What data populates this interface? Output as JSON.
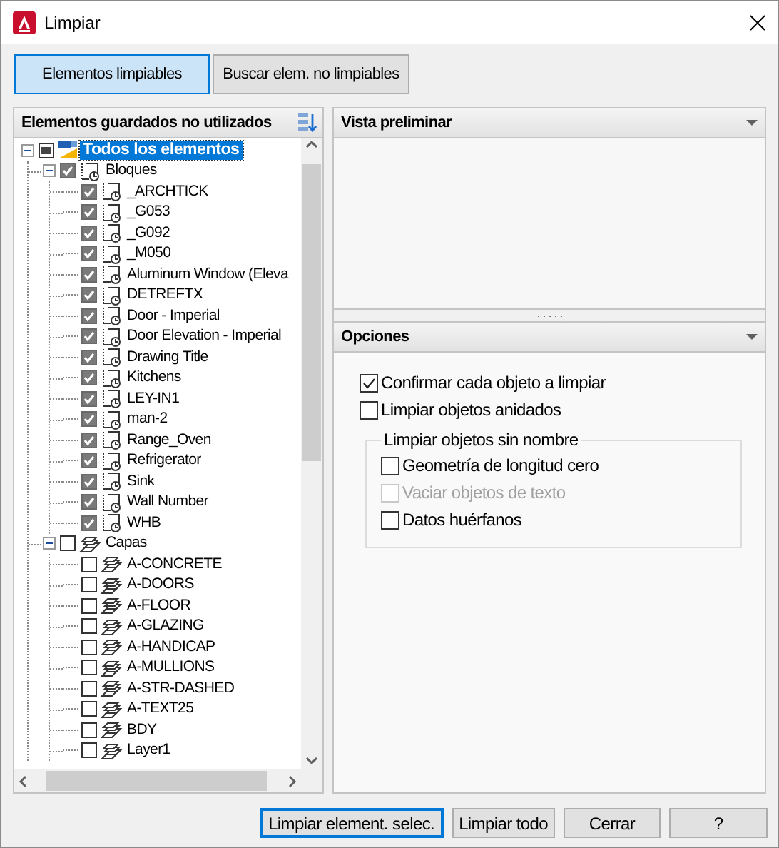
{
  "window": {
    "title": "Limpiar"
  },
  "mode_tabs": [
    {
      "label": "Elementos limpiables",
      "selected": true
    },
    {
      "label": "Buscar elem. no limpiables",
      "selected": false
    }
  ],
  "tree_panel": {
    "title": "Elementos guardados no utilizados",
    "root": {
      "label": "Todos los elementos",
      "kind": "all",
      "selected": true,
      "expanded": true,
      "indeterminate": true,
      "children": [
        {
          "label": "Bloques",
          "kind": "block",
          "selected": false,
          "expanded": true,
          "checked": true,
          "children": [
            {
              "label": "_ARCHTICK",
              "kind": "block",
              "selected": false,
              "checked": true
            },
            {
              "label": "_G053",
              "kind": "block",
              "selected": false,
              "checked": true
            },
            {
              "label": "_G092",
              "kind": "block",
              "selected": false,
              "checked": true
            },
            {
              "label": "_M050",
              "kind": "block",
              "selected": false,
              "checked": true
            },
            {
              "label": "Aluminum Window (Eleva",
              "kind": "block",
              "selected": false,
              "checked": true
            },
            {
              "label": "DETREFTX",
              "kind": "block",
              "selected": false,
              "checked": true
            },
            {
              "label": "Door - Imperial",
              "kind": "block",
              "selected": false,
              "checked": true
            },
            {
              "label": "Door Elevation - Imperial",
              "kind": "block",
              "selected": false,
              "checked": true
            },
            {
              "label": "Drawing Title",
              "kind": "block",
              "selected": false,
              "checked": true
            },
            {
              "label": "Kitchens",
              "kind": "block",
              "selected": false,
              "checked": true
            },
            {
              "label": "LEY-IN1",
              "kind": "block",
              "selected": false,
              "checked": true
            },
            {
              "label": "man-2",
              "kind": "block",
              "selected": false,
              "checked": true
            },
            {
              "label": "Range_Oven",
              "kind": "block",
              "selected": false,
              "checked": true
            },
            {
              "label": "Refrigerator",
              "kind": "block",
              "selected": false,
              "checked": true
            },
            {
              "label": "Sink",
              "kind": "block",
              "selected": false,
              "checked": true
            },
            {
              "label": "Wall Number",
              "kind": "block",
              "selected": false,
              "checked": true
            },
            {
              "label": "WHB",
              "kind": "block",
              "selected": false,
              "checked": true
            }
          ]
        },
        {
          "label": "Capas",
          "kind": "layer",
          "selected": false,
          "expanded": true,
          "checked": false,
          "children": [
            {
              "label": "A-CONCRETE",
              "kind": "layer",
              "selected": false,
              "checked": false
            },
            {
              "label": "A-DOORS",
              "kind": "layer",
              "selected": false,
              "checked": false
            },
            {
              "label": "A-FLOOR",
              "kind": "layer",
              "selected": false,
              "checked": false
            },
            {
              "label": "A-GLAZING",
              "kind": "layer",
              "selected": false,
              "checked": false
            },
            {
              "label": "A-HANDICAP",
              "kind": "layer",
              "selected": false,
              "checked": false
            },
            {
              "label": "A-MULLIONS",
              "kind": "layer",
              "selected": false,
              "checked": false
            },
            {
              "label": "A-STR-DASHED",
              "kind": "layer",
              "selected": false,
              "checked": false
            },
            {
              "label": "A-TEXT25",
              "kind": "layer",
              "selected": false,
              "checked": false
            },
            {
              "label": "BDY",
              "kind": "layer",
              "selected": false,
              "checked": false
            },
            {
              "label": "Layer1",
              "kind": "layer",
              "selected": false,
              "checked": false
            }
          ]
        }
      ]
    }
  },
  "preview_panel": {
    "title": "Vista preliminar"
  },
  "options_panel": {
    "title": "Opciones",
    "options": [
      {
        "label": "Confirmar cada objeto a limpiar",
        "checked": true,
        "disabled": false
      },
      {
        "label": "Limpiar objetos anidados",
        "checked": false,
        "disabled": false
      }
    ],
    "unnamed_group": {
      "title": "Limpiar objetos sin nombre",
      "options": [
        {
          "label": "Geometría de longitud cero",
          "checked": false,
          "disabled": false
        },
        {
          "label": "Vaciar objetos de texto",
          "checked": false,
          "disabled": true
        },
        {
          "label": "Datos huérfanos",
          "checked": false,
          "disabled": false
        }
      ]
    }
  },
  "buttons": [
    {
      "label": "Limpiar element. selec.",
      "focused": true
    },
    {
      "label": "Limpiar todo",
      "focused": false
    },
    {
      "label": "Cerrar",
      "focused": false
    },
    {
      "label": "?",
      "focused": false
    }
  ]
}
